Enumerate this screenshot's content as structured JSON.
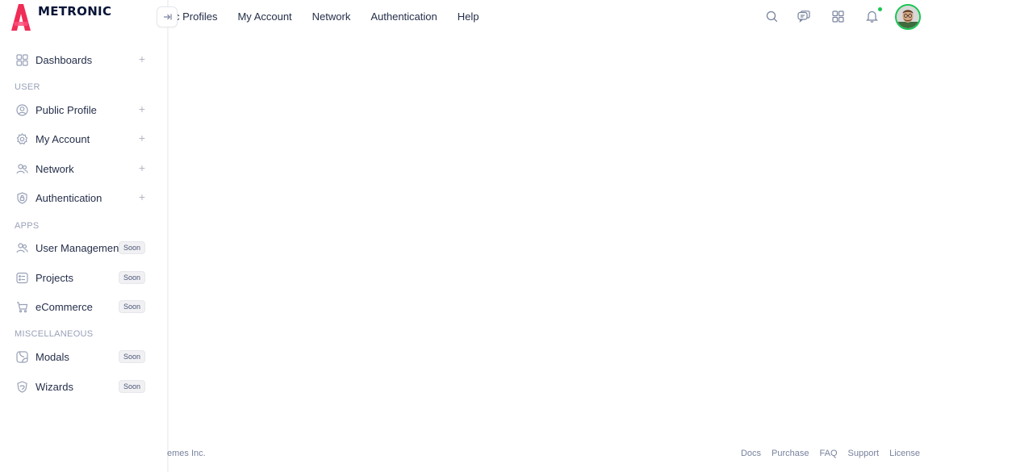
{
  "brand": {
    "name": "METRONIC",
    "accent": "#ef2d56"
  },
  "sidebar": {
    "items": [
      {
        "label": "Dashboards",
        "icon": "grid-icon",
        "trailing": "+"
      },
      {
        "label": "Public Profile",
        "icon": "user-circle-icon",
        "trailing": "+"
      },
      {
        "label": "My Account",
        "icon": "gear-icon",
        "trailing": "+"
      },
      {
        "label": "Network",
        "icon": "users-icon",
        "trailing": "+"
      },
      {
        "label": "Authentication",
        "icon": "shield-icon",
        "trailing": "+"
      },
      {
        "label": "User Management",
        "icon": "users-icon",
        "badge": "Soon"
      },
      {
        "label": "Projects",
        "icon": "checklist-icon",
        "badge": "Soon"
      },
      {
        "label": "eCommerce",
        "icon": "cart-icon",
        "badge": "Soon"
      },
      {
        "label": "Modals",
        "icon": "modal-icon",
        "badge": "Soon"
      },
      {
        "label": "Wizards",
        "icon": "badge-icon",
        "badge": "Soon"
      }
    ],
    "sections": {
      "user": "USER",
      "apps": "APPS",
      "misc": "MISCELLANEOUS"
    }
  },
  "header": {
    "nav": [
      "c Profiles",
      "My Account",
      "Network",
      "Authentication",
      "Help"
    ],
    "icons": [
      "search-icon",
      "chat-icon",
      "apps-icon",
      "bell-icon"
    ],
    "notification_color": "#17c653"
  },
  "footer": {
    "copyright": "emes Inc.",
    "links": [
      "Docs",
      "Purchase",
      "FAQ",
      "Support",
      "License"
    ]
  }
}
